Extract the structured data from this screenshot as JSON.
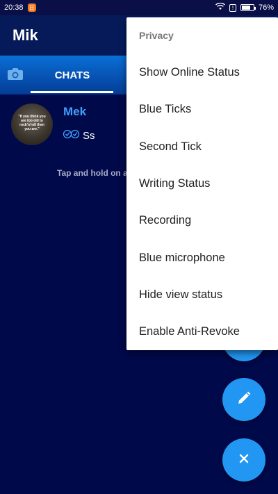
{
  "status_bar": {
    "time": "20:38",
    "notif_glyph": "日",
    "sim_glyph": "!",
    "battery_level": 0.76,
    "battery_text": "76%"
  },
  "app_bar": {
    "title": "Mik"
  },
  "tabs": {
    "camera_icon": "camera-icon",
    "chats_label": "CHATS"
  },
  "chats": [
    {
      "name": "Mek",
      "avatar_text": "\"If you think you are too old to rock'n'roll then you are.\"",
      "status_ticks": "read-ticks",
      "preview": "Ss"
    }
  ],
  "hint": "Tap and hold on a",
  "menu": {
    "header": "Privacy",
    "items": [
      "Show Online Status",
      "Blue Ticks",
      "Second Tick",
      "Writing Status",
      "Recording",
      "Blue microphone",
      "Hide view status",
      "Enable Anti-Revoke"
    ]
  },
  "fabs": {
    "edit_icon": "pencil-icon",
    "close_icon": "close-icon"
  },
  "colors": {
    "background": "#00094a",
    "accent": "#2196f3",
    "chat_name": "#3fa0ff",
    "tab_gradient_top": "#0a6fd6",
    "tab_gradient_bottom": "#043c95"
  }
}
